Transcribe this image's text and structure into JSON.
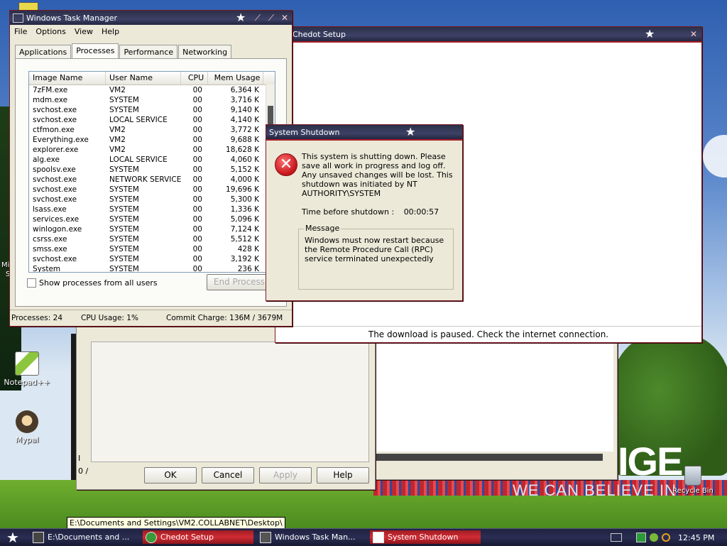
{
  "desktop": {
    "icons": [
      {
        "label": "Notepad++"
      },
      {
        "label": "Mypal"
      }
    ],
    "recycle_bin": "Recycle Bin",
    "wallpaper_big": "IGE",
    "wallpaper_slogan": "WE CAN BELIEVE IN",
    "edge_label_1": "Mi",
    "edge_label_2": "S"
  },
  "chedot": {
    "title": "Chedot Setup",
    "status": "The download is paused. Check the internet connection."
  },
  "props_dialog": {
    "ok": "OK",
    "cancel": "Cancel",
    "apply": "Apply",
    "help": "Help",
    "fragment_1": "I",
    "fragment_2": "0 /"
  },
  "task_manager": {
    "title": "Windows Task Manager",
    "menu": [
      "File",
      "Options",
      "View",
      "Help"
    ],
    "tabs": [
      "Applications",
      "Processes",
      "Performance",
      "Networking"
    ],
    "active_tab": "Processes",
    "columns": [
      "Image Name",
      "User Name",
      "CPU",
      "Mem Usage"
    ],
    "rows": [
      [
        "7zFM.exe",
        "VM2",
        "00",
        "6,364 K"
      ],
      [
        "mdm.exe",
        "SYSTEM",
        "00",
        "3,716 K"
      ],
      [
        "svchost.exe",
        "SYSTEM",
        "00",
        "9,140 K"
      ],
      [
        "svchost.exe",
        "LOCAL SERVICE",
        "00",
        "4,140 K"
      ],
      [
        "ctfmon.exe",
        "VM2",
        "00",
        "3,772 K"
      ],
      [
        "Everything.exe",
        "VM2",
        "00",
        "9,688 K"
      ],
      [
        "explorer.exe",
        "VM2",
        "00",
        "18,628 K"
      ],
      [
        "alg.exe",
        "LOCAL SERVICE",
        "00",
        "4,060 K"
      ],
      [
        "spoolsv.exe",
        "SYSTEM",
        "00",
        "5,152 K"
      ],
      [
        "svchost.exe",
        "NETWORK SERVICE",
        "00",
        "4,000 K"
      ],
      [
        "svchost.exe",
        "SYSTEM",
        "00",
        "19,696 K"
      ],
      [
        "svchost.exe",
        "SYSTEM",
        "00",
        "5,300 K"
      ],
      [
        "lsass.exe",
        "SYSTEM",
        "00",
        "1,336 K"
      ],
      [
        "services.exe",
        "SYSTEM",
        "00",
        "5,096 K"
      ],
      [
        "winlogon.exe",
        "SYSTEM",
        "00",
        "7,124 K"
      ],
      [
        "csrss.exe",
        "SYSTEM",
        "00",
        "5,512 K"
      ],
      [
        "smss.exe",
        "SYSTEM",
        "00",
        "428 K"
      ],
      [
        "svchost.exe",
        "SYSTEM",
        "00",
        "3,192 K"
      ],
      [
        "System",
        "SYSTEM",
        "00",
        "236 K"
      ]
    ],
    "show_all_label": "Show processes from all users",
    "end_process": "End Process",
    "status_processes": "Processes: 24",
    "status_cpu": "CPU Usage: 1%",
    "status_commit": "Commit Charge: 136M / 3679M"
  },
  "shutdown": {
    "title": "System Shutdown",
    "message": "This system is shutting down. Please save all work in progress and log off. Any unsaved changes will be lost. This shutdown was initiated by NT AUTHORITY\\SYSTEM",
    "time_label": "Time before shutdown :",
    "time_value": "00:00:57",
    "group_label": "Message",
    "group_text": "Windows must now restart because the Remote Procedure Call (RPC) service terminated unexpectedly"
  },
  "tooltip": "E:\\Documents and Settings\\VM2.COLLABNET\\Desktop\\",
  "taskbar": {
    "buttons": [
      {
        "label": "E:\\Documents and ..."
      },
      {
        "label": "Chedot Setup"
      },
      {
        "label": "Windows Task Man..."
      },
      {
        "label": "System Shutdown"
      }
    ],
    "clock": "12:45 PM"
  },
  "colors": {
    "title_bar": "#2b2f49",
    "accent_red": "#a51e27"
  }
}
